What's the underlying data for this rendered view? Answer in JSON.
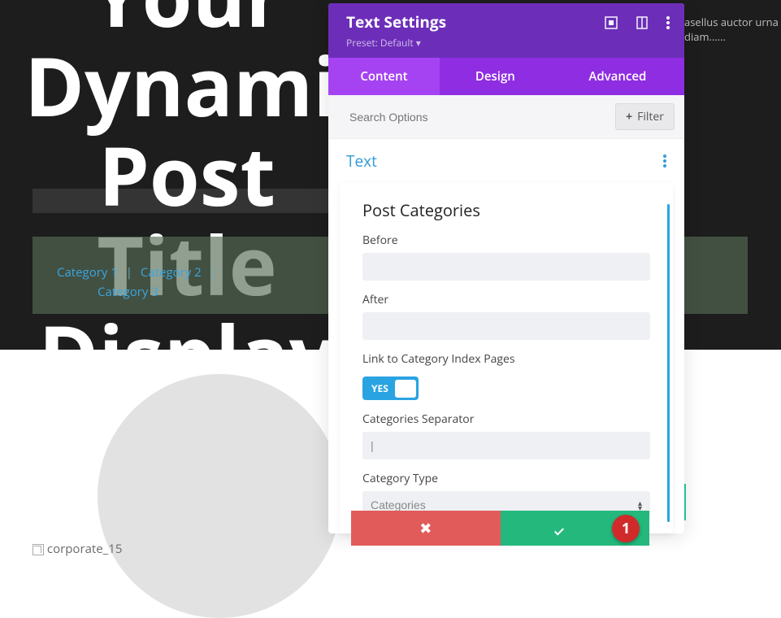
{
  "hero": {
    "title_line1": "Your Dynamic",
    "title_line2": "Post Title",
    "title_line3": "Display"
  },
  "side_paragraph": {
    "l1": "asellus auctor urna",
    "l2": "diam......"
  },
  "categories": {
    "c1": "Category 1",
    "c2": "Category 2",
    "c3": "Category 3",
    "sep": "|"
  },
  "footer_img": {
    "caption": "corporate_15"
  },
  "modal": {
    "title": "Text Settings",
    "preset": "Preset: Default ▾",
    "tabs": {
      "content": "Content",
      "design": "Design",
      "advanced": "Advanced"
    },
    "search_placeholder": "Search Options",
    "filter": "Filter",
    "section": "Text",
    "card_title": "Post Categories",
    "labels": {
      "before": "Before",
      "after": "After",
      "link_cat": "Link to Category Index Pages",
      "separator": "Categories Separator",
      "cat_type": "Category Type"
    },
    "values": {
      "before": "",
      "after": "",
      "separator": "|",
      "cat_type_selected": "Categories"
    },
    "toggle_yes": "YES",
    "badge": "1"
  }
}
